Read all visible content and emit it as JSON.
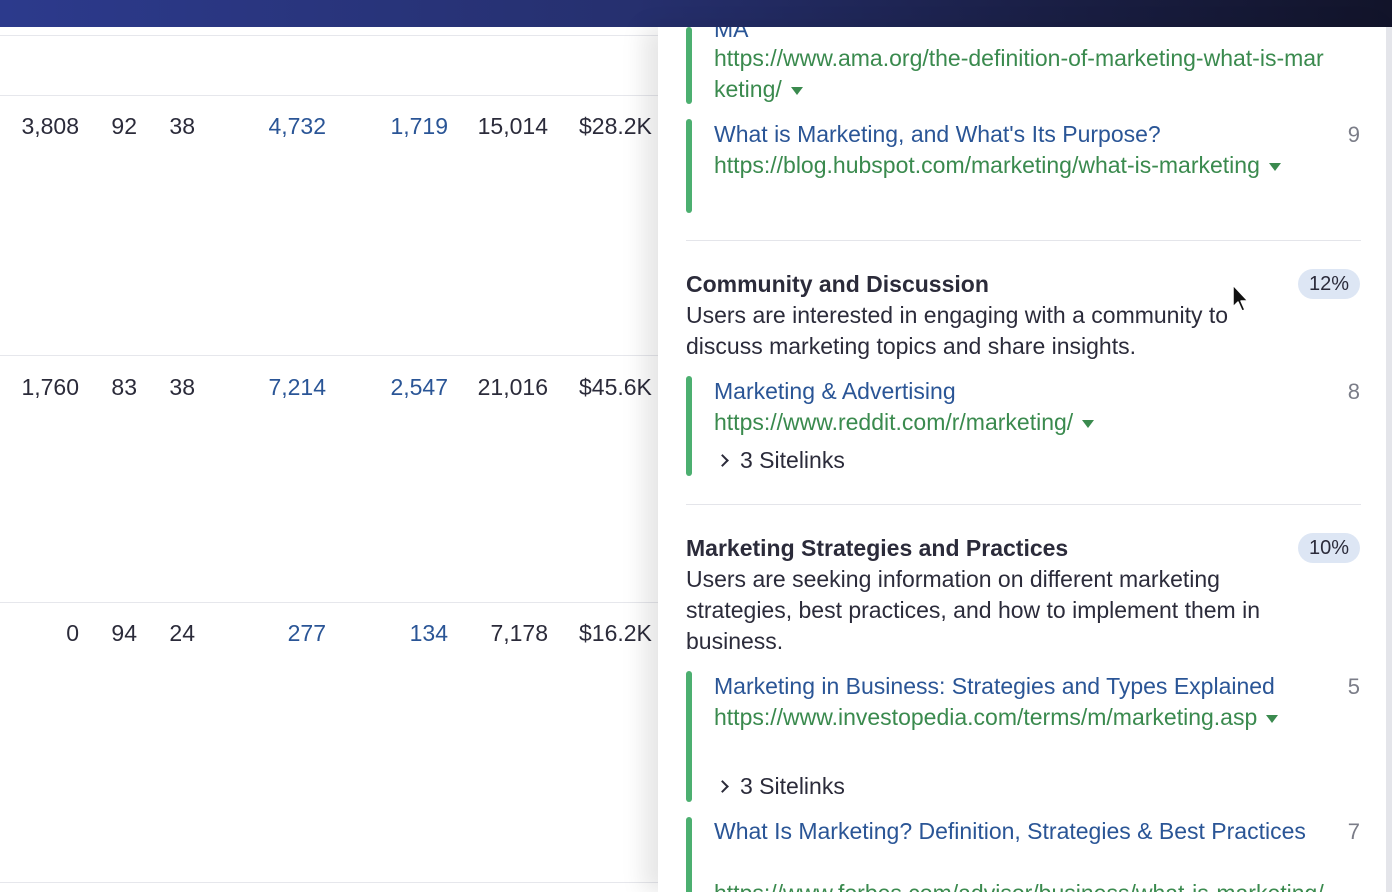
{
  "table": {
    "rows": [
      {
        "c1": "3,808",
        "c2": "92",
        "c3": "38",
        "c4": "4,732",
        "c5": "1,719",
        "c6": "15,014",
        "c7": "$28.2K"
      },
      {
        "c1": "1,760",
        "c2": "83",
        "c3": "38",
        "c4": "7,214",
        "c5": "2,547",
        "c6": "21,016",
        "c7": "$45.6K"
      },
      {
        "c1": "0",
        "c2": "94",
        "c3": "24",
        "c4": "277",
        "c5": "134",
        "c6": "7,178",
        "c7": "$16.2K"
      }
    ]
  },
  "panel": {
    "top_results": [
      {
        "title": "MA",
        "url": "https://www.ama.org/the-definition-of-marketing-what-is-marketing/",
        "rank": ""
      },
      {
        "title": "What is Marketing, and What's Its Purpose?",
        "url": "https://blog.hubspot.com/marketing/what-is-marketing",
        "rank": "9"
      }
    ],
    "sections": [
      {
        "title": "Community and Discussion",
        "percent": "12%",
        "description": "Users are interested in engaging with a community to discuss marketing topics and share insights.",
        "results": [
          {
            "title": "Marketing & Advertising",
            "url": "https://www.reddit.com/r/marketing/",
            "rank": "8",
            "sitelinks": "3 Sitelinks"
          }
        ]
      },
      {
        "title": "Marketing Strategies and Practices",
        "percent": "10%",
        "description": "Users are seeking information on different marketing strategies, best practices, and how to implement them in business.",
        "results": [
          {
            "title": "Marketing in Business: Strategies and Types Explained",
            "url": "https://www.investopedia.com/terms/m/marketing.asp",
            "rank": "5",
            "sitelinks": "3 Sitelinks"
          },
          {
            "title": "What Is Marketing? Definition, Strategies & Best Practices",
            "url": "https://www.forbes.com/advisor/business/what-is-marketing/",
            "rank": "7"
          }
        ]
      }
    ]
  }
}
